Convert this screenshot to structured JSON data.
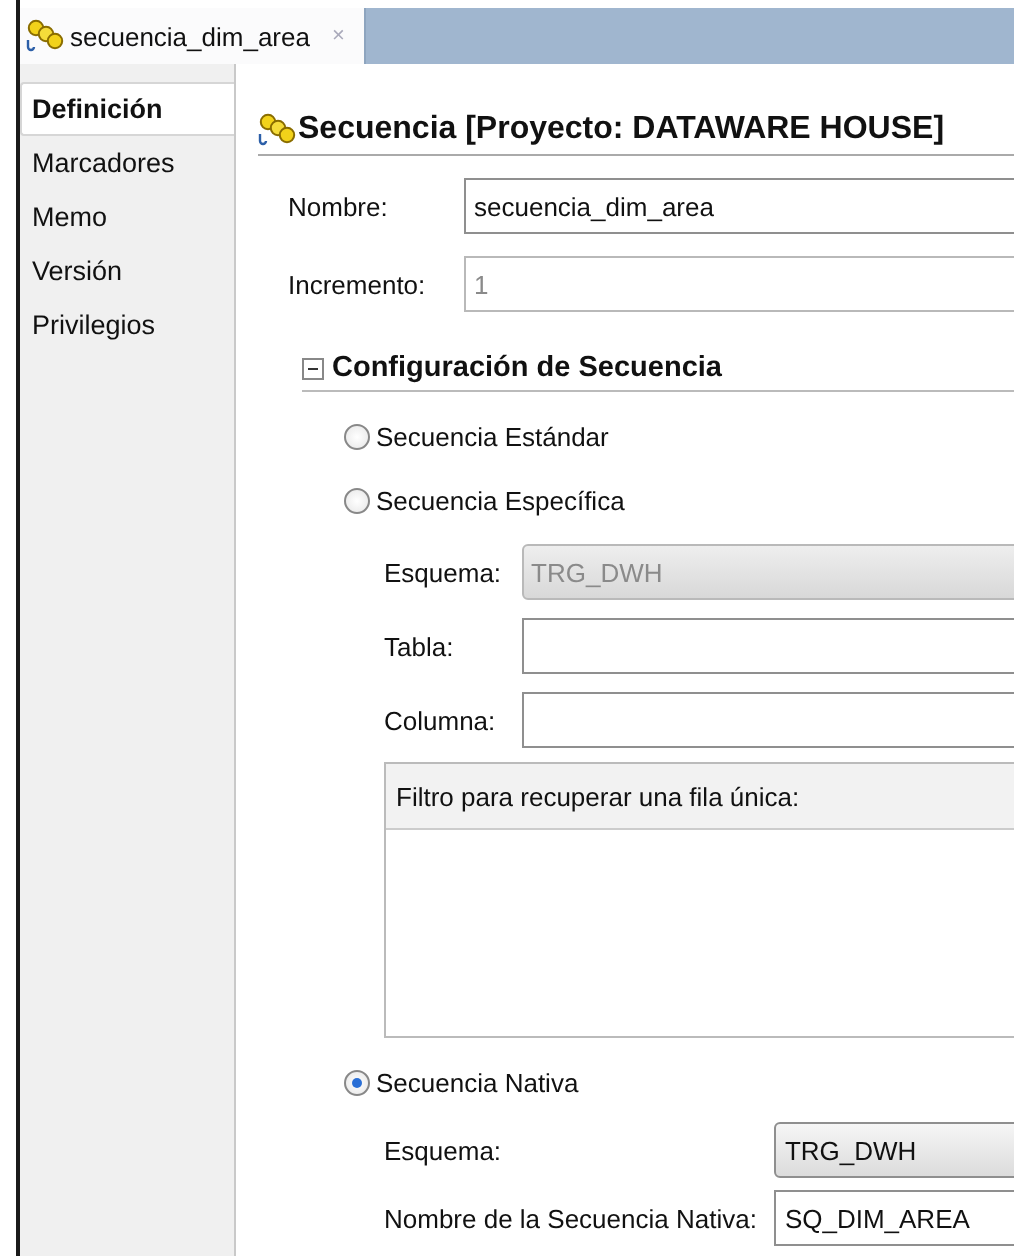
{
  "tab": {
    "title": "secuencia_dim_area",
    "close": "×",
    "selected": true
  },
  "sidebar": {
    "items": [
      {
        "label": "Definición",
        "selected": true
      },
      {
        "label": "Marcadores",
        "selected": false
      },
      {
        "label": "Memo",
        "selected": false
      },
      {
        "label": "Versión",
        "selected": false
      },
      {
        "label": "Privilegios",
        "selected": false
      }
    ]
  },
  "heading": "Secuencia [Proyecto: DATAWARE HOUSE]",
  "fields": [
    {
      "label": "Nombre:",
      "value": "secuencia_dim_area",
      "disabled": false
    },
    {
      "label": "Incremento:",
      "value": "1",
      "disabled": true
    }
  ],
  "section": {
    "title": "Configuración de Secuencia",
    "expanded": true,
    "options": [
      {
        "label": "Secuencia Estándar",
        "selected": false
      },
      {
        "label": "Secuencia Específica",
        "selected": false,
        "fields": [
          {
            "kind": "combo",
            "label": "Esquema:",
            "value": "TRG_DWH",
            "disabled": true
          },
          {
            "kind": "text",
            "label": "Tabla:",
            "disabled": false
          },
          {
            "kind": "text",
            "label": "Columna:",
            "disabled": false
          },
          {
            "kind": "area",
            "label": "Filtro para recuperar una fila única:"
          }
        ]
      },
      {
        "label": "Secuencia Nativa",
        "selected": true,
        "fields": [
          {
            "kind": "combo",
            "label": "Esquema:",
            "value": "TRG_DWH",
            "disabled": false
          },
          {
            "kind": "text",
            "label": "Nombre de la Secuencia Nativa:",
            "value": "SQ_DIM_AREA",
            "disabled": false
          }
        ]
      }
    ]
  }
}
